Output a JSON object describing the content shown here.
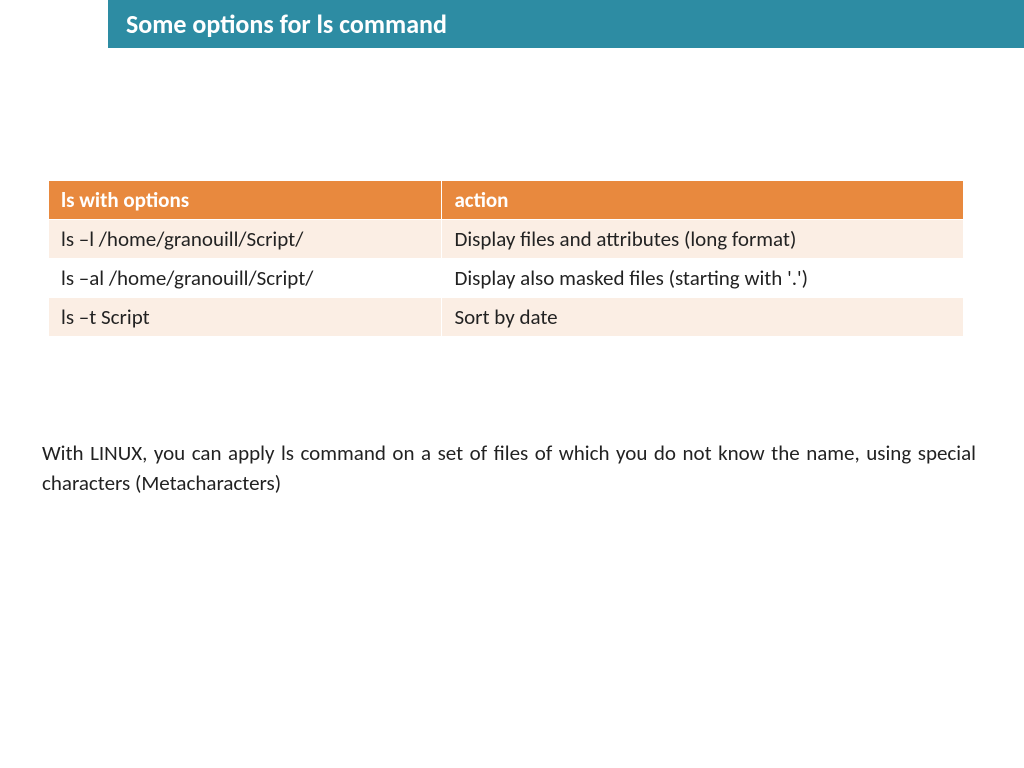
{
  "title": "Some options for ls command",
  "table": {
    "headers": {
      "col1": "ls with options",
      "col2": "action"
    },
    "rows": [
      {
        "col1": "ls –l /home/granouill/Script/",
        "col2": "Display files and attributes (long format)"
      },
      {
        "col1": "ls –al /home/granouill/Script/",
        "col2": "Display also masked files (starting with '.')"
      },
      {
        "col1": "ls –t Script",
        "col2": "Sort by date"
      }
    ]
  },
  "paragraph": "With LINUX, you can apply ls command on a set of files of which you do not know the name, using special characters (Metacharacters)"
}
